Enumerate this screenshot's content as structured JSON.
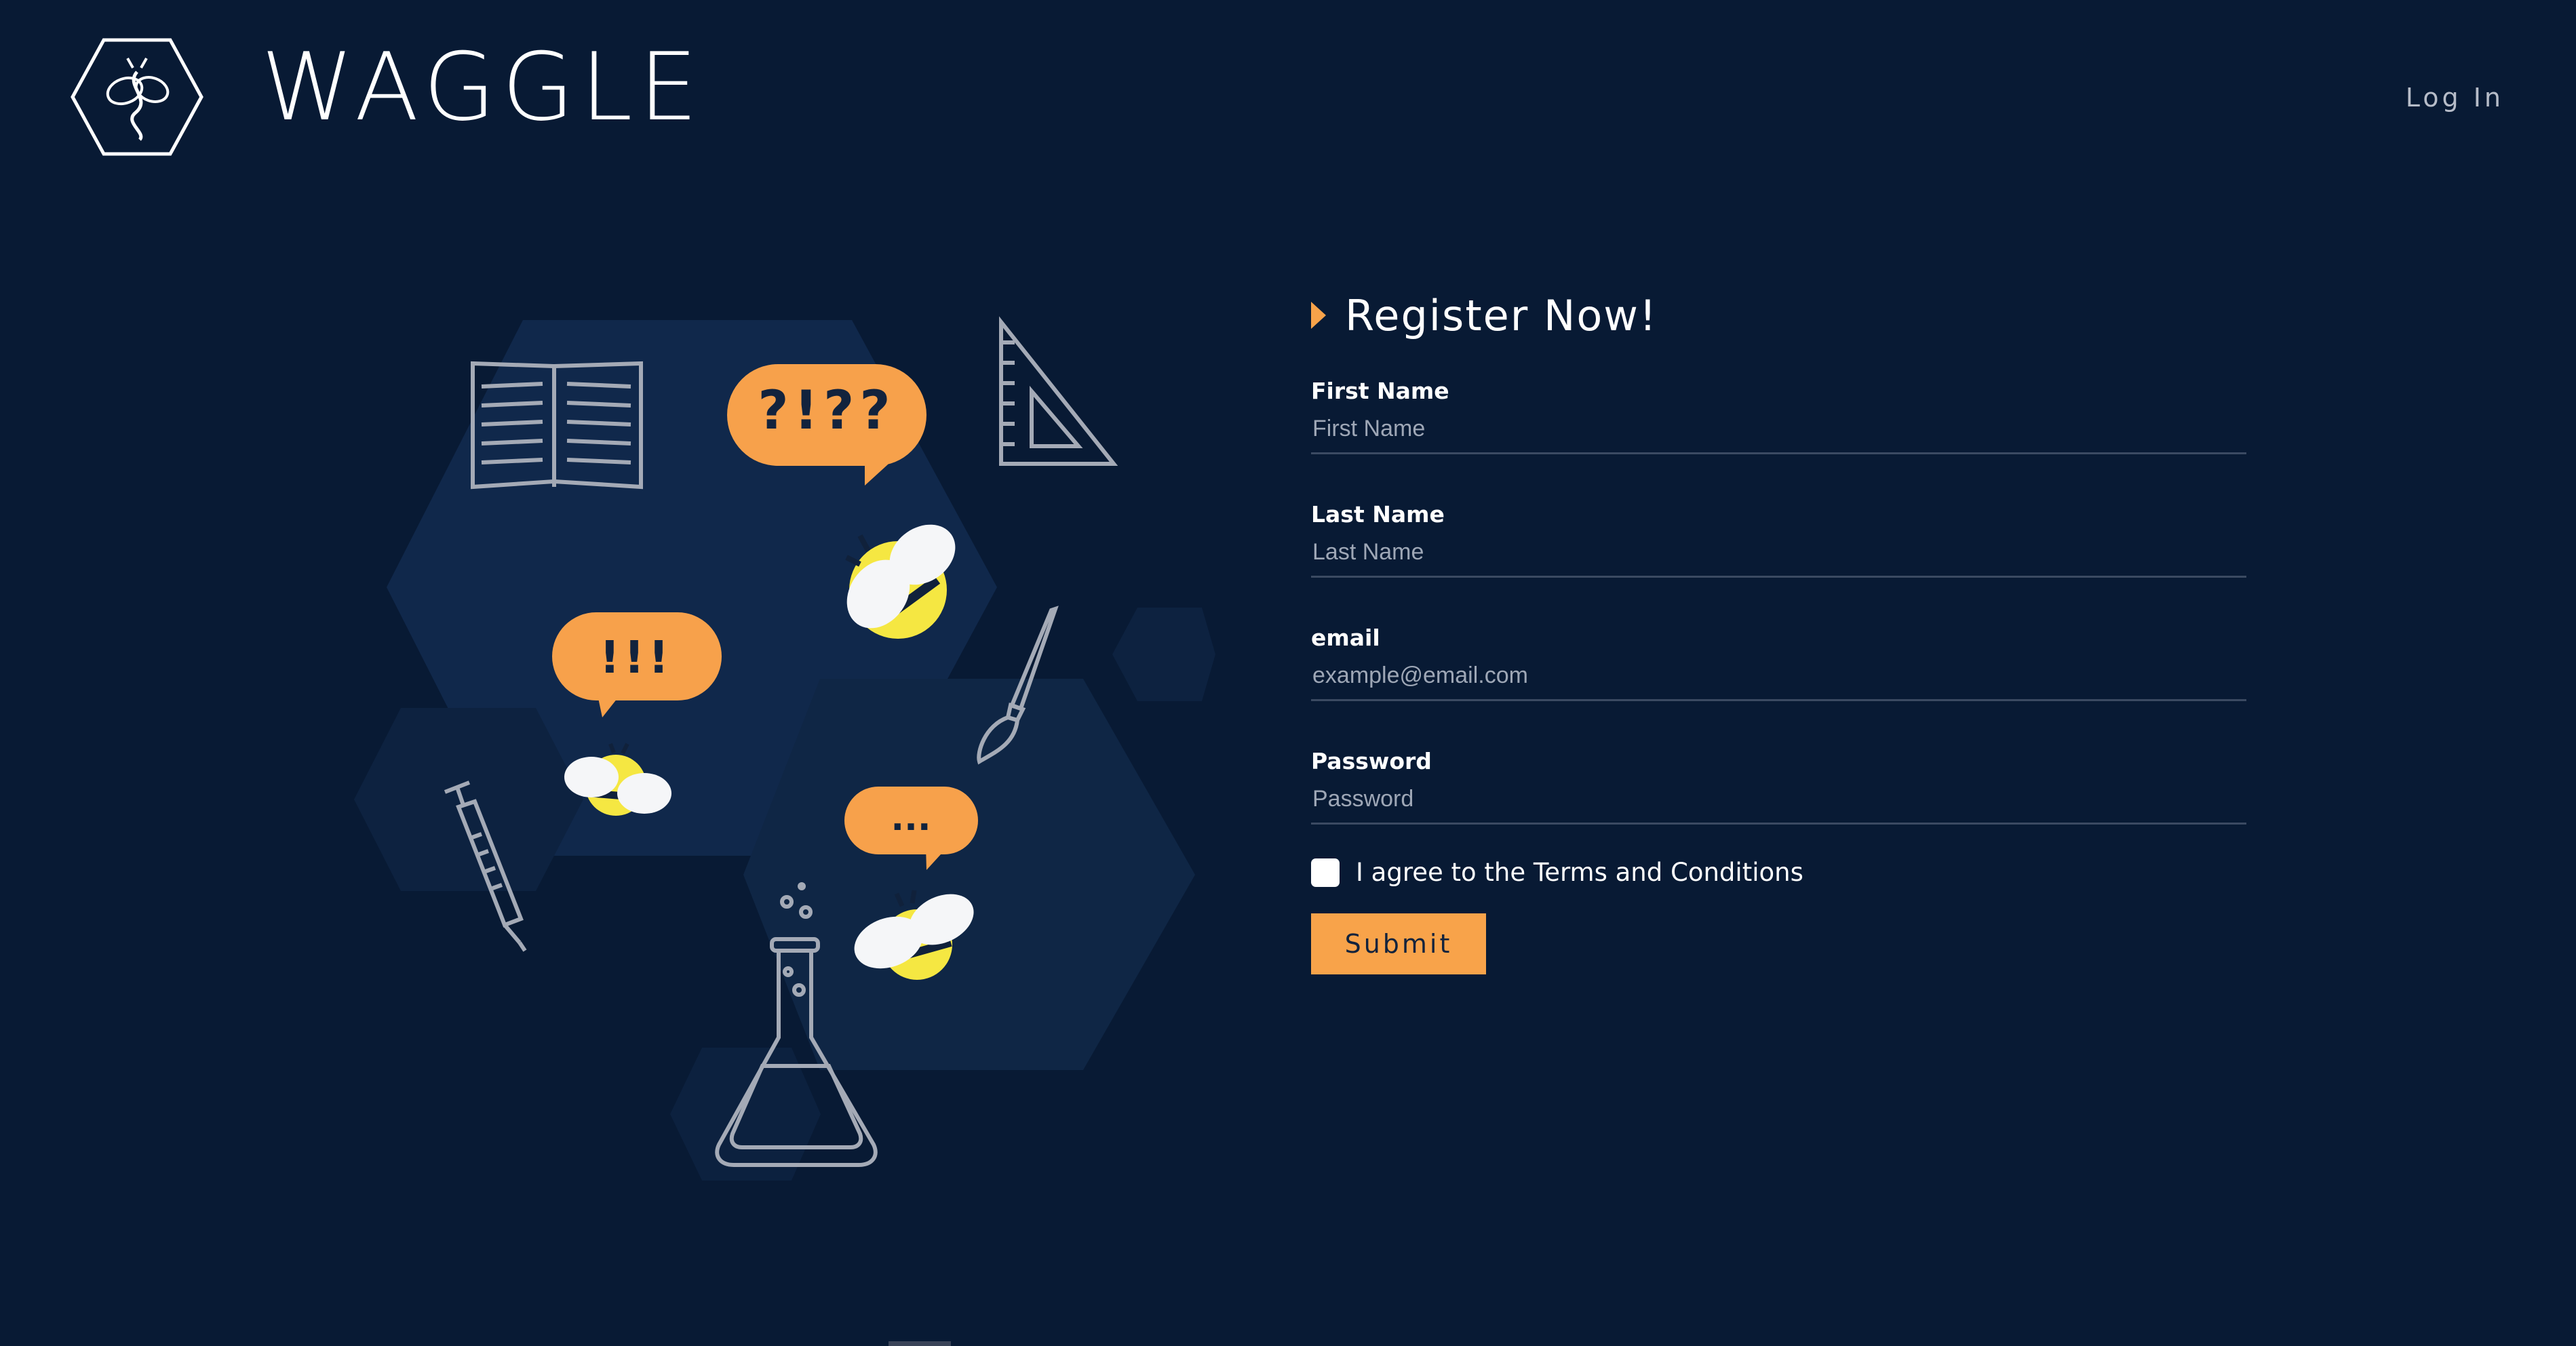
{
  "header": {
    "brand": "WAGGLE",
    "login_label": "Log In"
  },
  "illustration": {
    "bubble_1": "?!??",
    "bubble_2": "!!!",
    "bubble_3": "..."
  },
  "form": {
    "title": "Register Now!",
    "fields": [
      {
        "label": "First Name",
        "placeholder": "First Name",
        "value": ""
      },
      {
        "label": "Last Name",
        "placeholder": "Last Name",
        "value": ""
      },
      {
        "label": "email",
        "placeholder": "example@email.com",
        "value": ""
      },
      {
        "label": "Password",
        "placeholder": "Password",
        "value": ""
      }
    ],
    "terms_label": "I agree to the Terms and Conditions",
    "terms_checked": false,
    "submit_label": "Submit"
  },
  "colors": {
    "background": "#081a34",
    "accent": "#f8a34a",
    "hexagon": "#0f2a4b",
    "bee_yellow": "#f5e742"
  }
}
